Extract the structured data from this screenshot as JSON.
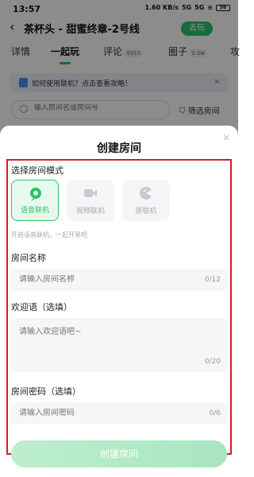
{
  "status": {
    "time": "13:57",
    "speed": "1.60 KB/s",
    "signal1": "5G",
    "signal2": "5G",
    "battery": "56"
  },
  "header": {
    "back_icon": "back-arrow-icon",
    "title": "茶杯头 - 甜蜜终章-2号线",
    "play_label": "去玩"
  },
  "tabs": [
    {
      "label": "详情"
    },
    {
      "label": "一起玩",
      "active": true
    },
    {
      "label": "评论",
      "count": "4910"
    },
    {
      "label": "圈子",
      "count": "3.3w"
    },
    {
      "label": "攻"
    }
  ],
  "tip": {
    "text": "如何使用联机？点击查看攻略！",
    "close": "×"
  },
  "search": {
    "placeholder": "输入房间名或房间号",
    "filter_label": "筛选房间"
  },
  "sheet": {
    "title": "创建房间",
    "close": "×",
    "mode_label": "选择房间模式",
    "modes": [
      {
        "label": "语音联机",
        "icon": "voice-chat-icon",
        "active": true
      },
      {
        "label": "视频联机",
        "icon": "video-camera-icon",
        "active": false
      },
      {
        "label": "原联机",
        "icon": "gamepad-icon",
        "active": false
      }
    ],
    "mode_hint": "开启语音联机，一起开黑吧",
    "room_name": {
      "label": "房间名称",
      "placeholder": "请输入房间名称",
      "count": "0/12"
    },
    "welcome": {
      "label": "欢迎语（选填）",
      "placeholder": "请输入欢迎语吧~",
      "count": "0/20"
    },
    "password": {
      "label": "房间密码（选填）",
      "placeholder": "请输入房间密码",
      "count": "0/6"
    },
    "create_label": "创建房间"
  },
  "colors": {
    "accent": "#2bc36a",
    "highlight": "#d81e1e"
  }
}
